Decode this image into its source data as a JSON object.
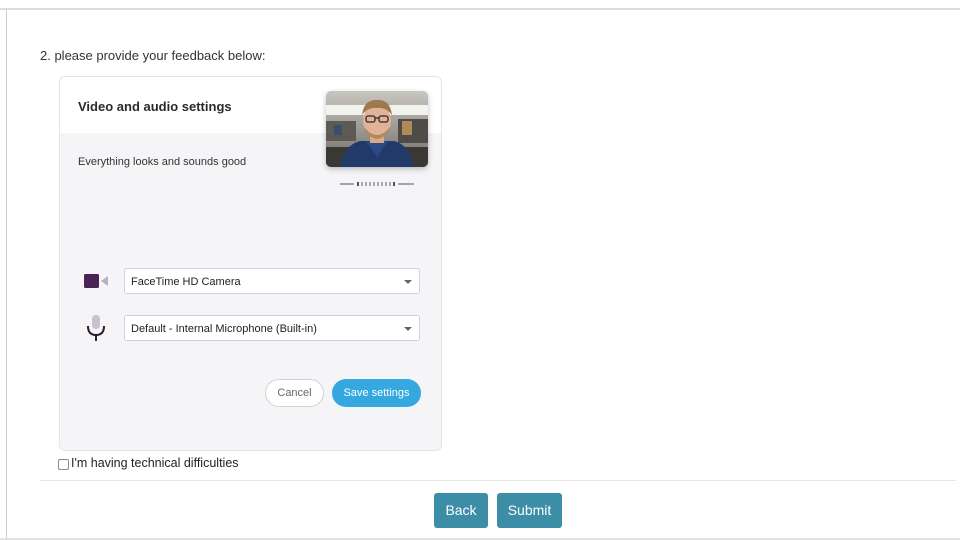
{
  "question": {
    "label": "2. please provide your feedback below:"
  },
  "settings_panel": {
    "title": "Video and audio settings",
    "status": "Everything looks and sounds good",
    "camera": {
      "icon": "video-camera-icon",
      "selected": "FaceTime HD Camera"
    },
    "microphone": {
      "icon": "microphone-icon",
      "selected": "Default - Internal Microphone (Built-in)"
    },
    "cancel_label": "Cancel",
    "save_label": "Save settings",
    "accent_color": "#35a8e0"
  },
  "difficulties": {
    "label": "I'm having technical difficulties",
    "checked": false
  },
  "navigation": {
    "back_label": "Back",
    "submit_label": "Submit",
    "button_color": "#3c8da6"
  }
}
